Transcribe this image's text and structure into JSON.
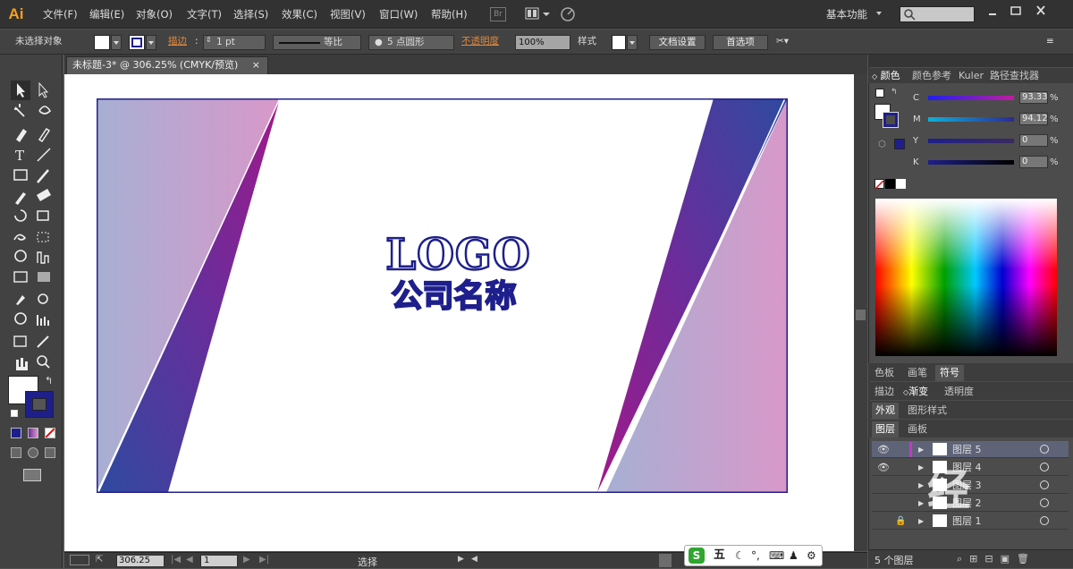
{
  "app": {
    "logo": "Ai",
    "workspace": "基本功能"
  },
  "menu": [
    "文件(F)",
    "编辑(E)",
    "对象(O)",
    "文字(T)",
    "选择(S)",
    "效果(C)",
    "视图(V)",
    "窗口(W)",
    "帮助(H)"
  ],
  "menubar_icons": {
    "bridge": "Br"
  },
  "control": {
    "selection": "未选择对象",
    "stroke_label": "描边",
    "stroke_weight": "1 pt",
    "stroke_profile": "等比",
    "brush": "5 点圆形",
    "opacity_label": "不透明度",
    "opacity": "100%",
    "style_label": "样式",
    "doc_setup": "文档设置",
    "preferences": "首选项"
  },
  "document": {
    "tab_title": "未标题-3* @ 306.25% (CMYK/预览)",
    "tab_close": "×"
  },
  "artwork": {
    "logo": "LOGO",
    "company": "公司名称",
    "colors": {
      "navy": "#1e1f8c",
      "blue": "#2e4aa0",
      "purple": "#6b2c9a",
      "magenta": "#a01a8a",
      "lavender": "#a7afd3",
      "pink": "#d898c9"
    }
  },
  "statusbar": {
    "zoom": "306.25",
    "page": "1",
    "mode": "选择"
  },
  "color_panel": {
    "tabs": [
      "颜色",
      "颜色参考",
      "Kuler",
      "路径查找器"
    ],
    "channels": [
      {
        "label": "C",
        "value": "93.33",
        "unit": "%"
      },
      {
        "label": "M",
        "value": "94.12",
        "unit": "%"
      },
      {
        "label": "Y",
        "value": "0",
        "unit": "%"
      },
      {
        "label": "K",
        "value": "0",
        "unit": "%"
      }
    ]
  },
  "swatch_panel": {
    "tabs": [
      "色板",
      "画笔",
      "符号"
    ]
  },
  "stroke_panel": {
    "tabs": [
      "描边",
      "渐变",
      "透明度"
    ]
  },
  "appearance_panel": {
    "tabs": [
      "外观",
      "图形样式"
    ]
  },
  "layers_panel": {
    "tabs": [
      "图层",
      "画板"
    ],
    "layers": [
      "图层 5",
      "图层 4",
      "图层 3",
      "图层 2",
      "图层 1"
    ],
    "count": "5 个图层"
  },
  "ime": {
    "mode": "五"
  },
  "watermark": {
    "text": "经"
  }
}
